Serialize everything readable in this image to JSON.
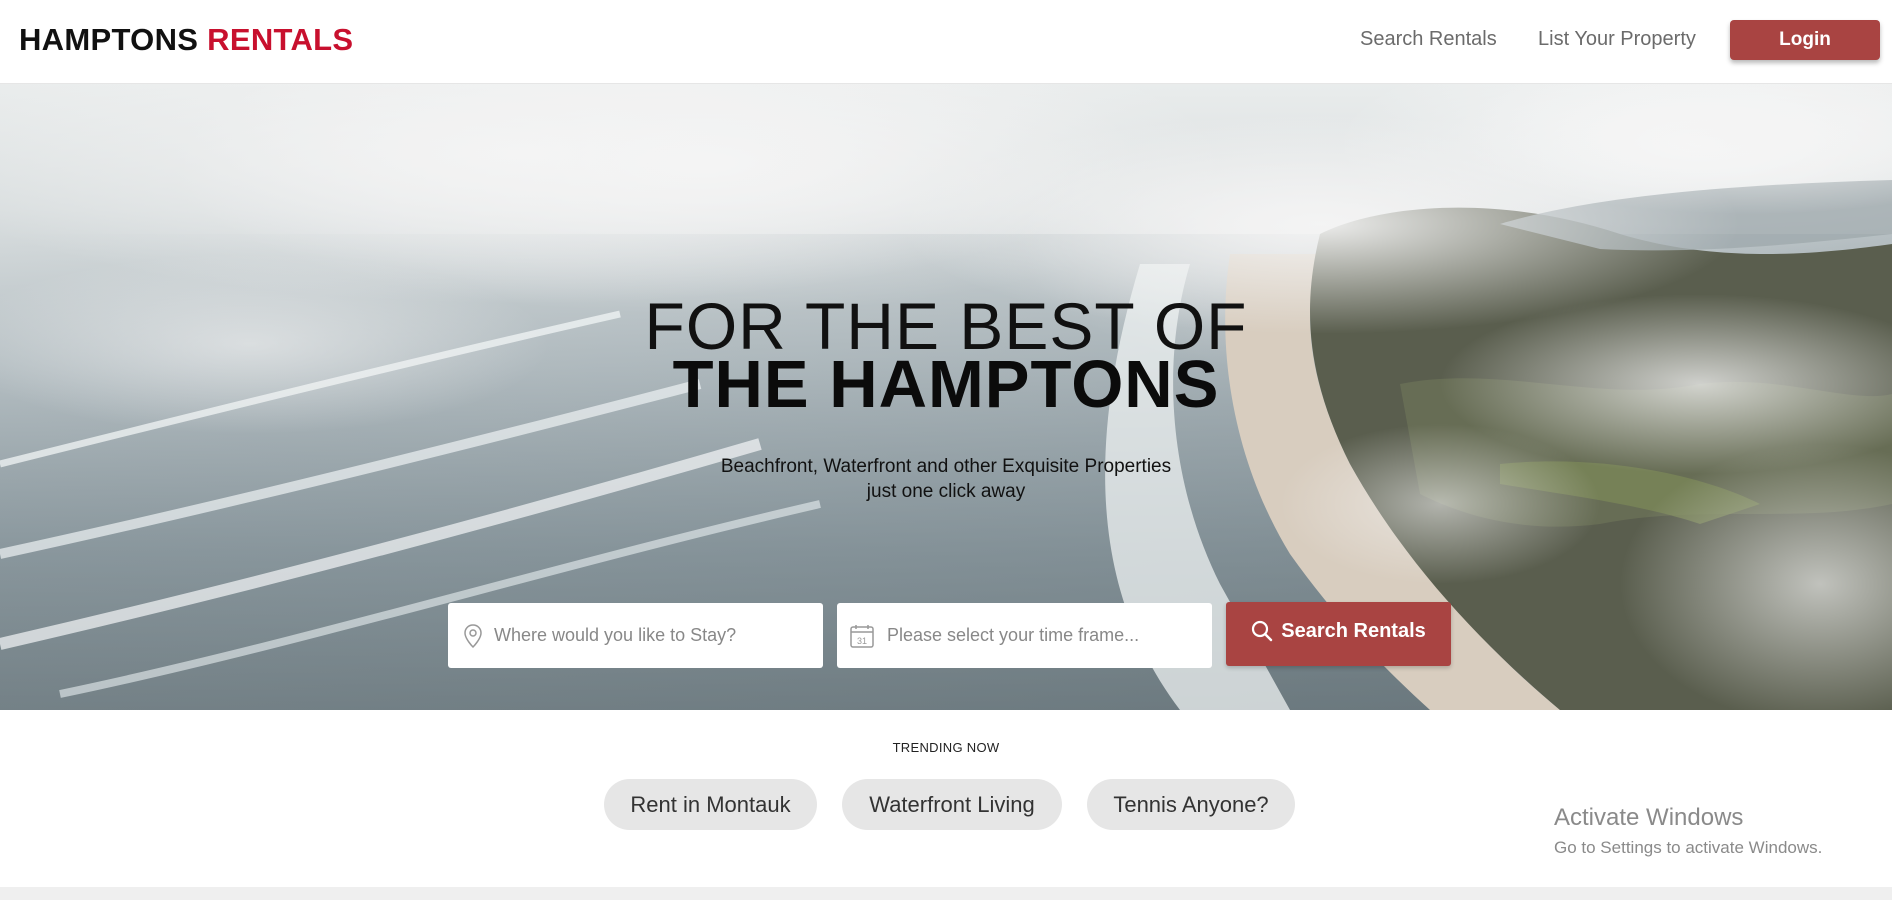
{
  "header": {
    "logo_part1": "HAMPTONS",
    "logo_part2": "RENTALS",
    "nav": [
      {
        "label": "Search Rentals"
      },
      {
        "label": "List Your Property"
      }
    ],
    "login_label": "Login"
  },
  "hero": {
    "title_line1": "FOR THE BEST OF",
    "title_line2": "THE HAMPTONS",
    "subtitle_line1": "Beachfront, Waterfront and other Exquisite Properties",
    "subtitle_line2": "just one click away"
  },
  "search": {
    "location_placeholder": "Where would you like to Stay?",
    "date_placeholder": "Please select your time frame...",
    "date_icon_number": "31",
    "button_label": "Search Rentals"
  },
  "trending": {
    "label": "TRENDING NOW",
    "items": [
      {
        "label": "Rent in Montauk"
      },
      {
        "label": "Waterfront Living"
      },
      {
        "label": "Tennis Anyone?"
      }
    ]
  },
  "watermark": {
    "title": "Activate Windows",
    "subtitle": "Go to Settings to activate Windows."
  },
  "colors": {
    "brand_red": "#c8102e",
    "button_red": "#a94442",
    "pill_bg": "#e6e6e6"
  },
  "icons": {
    "location": "map-pin-icon",
    "date": "calendar-icon",
    "search": "search-icon"
  }
}
